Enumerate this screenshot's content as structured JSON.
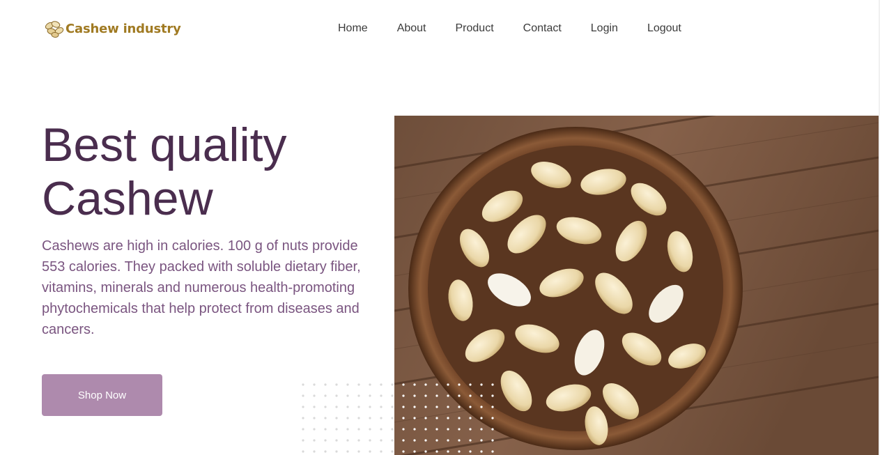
{
  "brand": {
    "name": "Cashew industry",
    "logo_icon": "cashew-nuts-icon",
    "color": "#a07a22"
  },
  "nav": {
    "items": [
      {
        "label": "Home"
      },
      {
        "label": "About"
      },
      {
        "label": "Product"
      },
      {
        "label": "Contact"
      },
      {
        "label": "Login"
      },
      {
        "label": "Logout"
      }
    ]
  },
  "hero": {
    "title": "Best quality Cashew",
    "description": "Cashews are high in calories. 100 g of nuts provide 553 calories. They packed with soluble dietary fiber, vitamins, minerals and numerous health-promoting phytochemicals that help protect from diseases and cancers.",
    "button_label": "Shop Now",
    "image_alt": "bowl-of-cashews-image"
  },
  "colors": {
    "title": "#4a2d4e",
    "text": "#7a5580",
    "button": "#ae8aad",
    "button_text": "#ffffff"
  }
}
